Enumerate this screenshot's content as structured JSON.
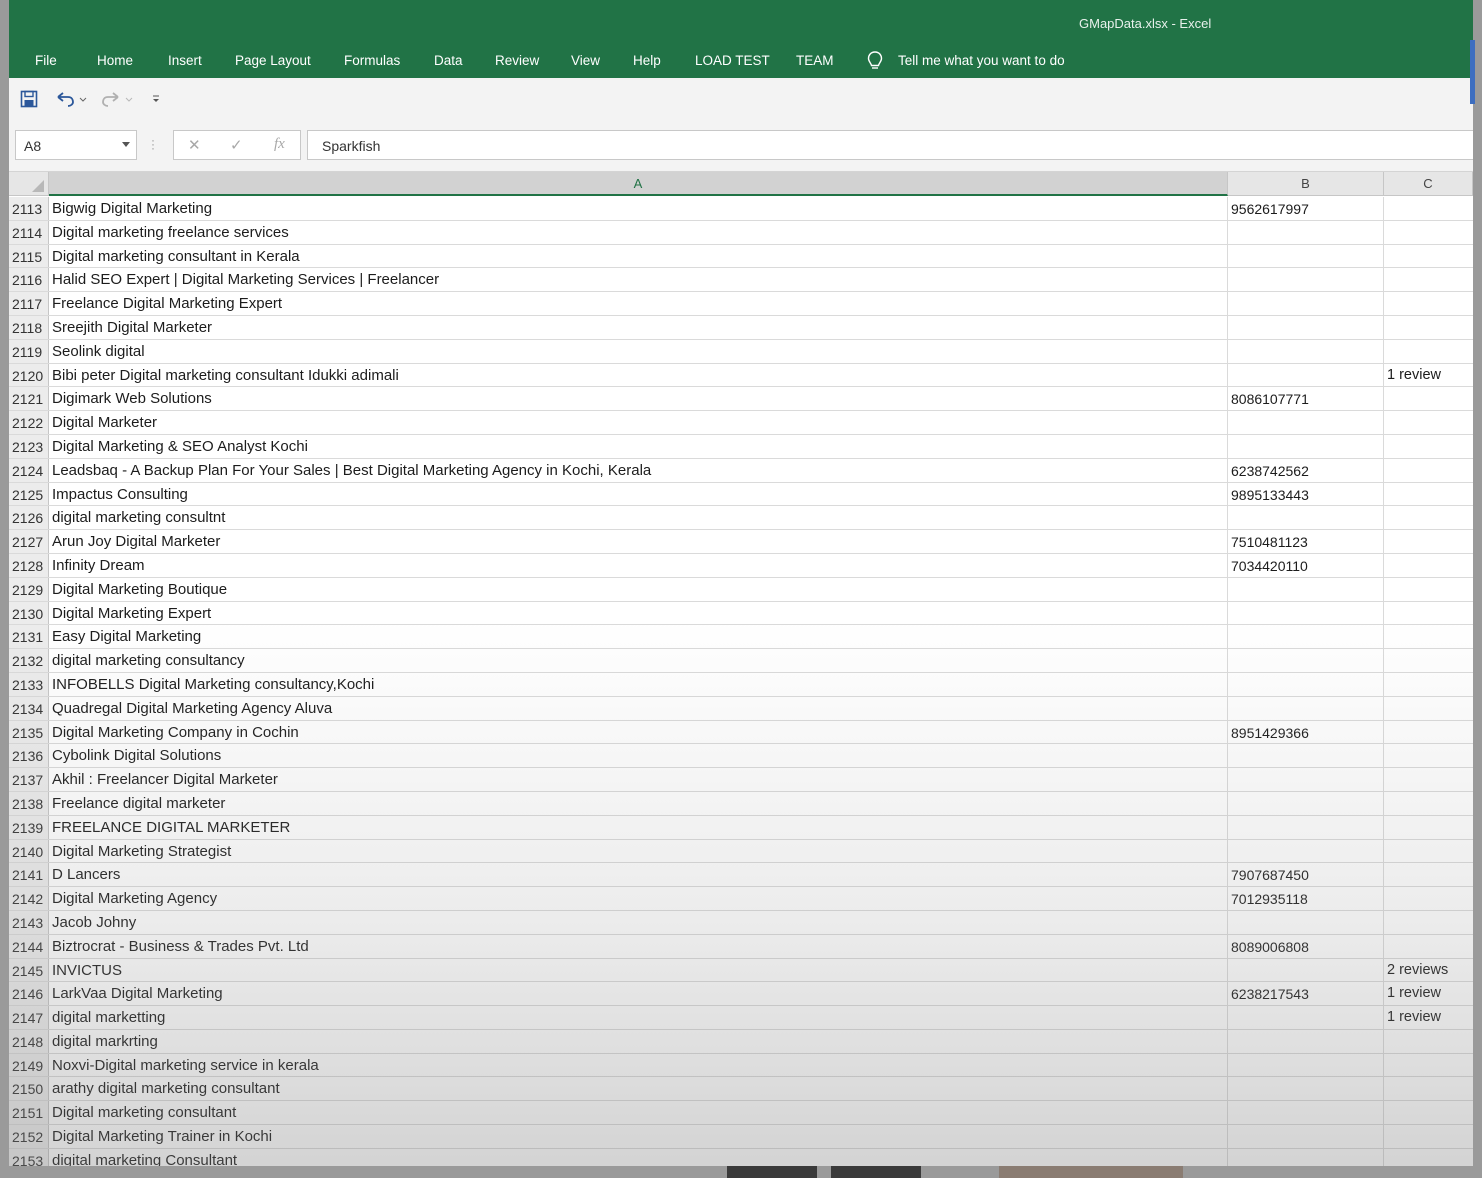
{
  "window": {
    "title": "GMapData.xlsx  -  Excel"
  },
  "menu": {
    "tabs": [
      "File",
      "Home",
      "Insert",
      "Page Layout",
      "Formulas",
      "Data",
      "Review",
      "View",
      "Help",
      "LOAD TEST",
      "TEAM"
    ],
    "tell_me": "Tell me what you want to do"
  },
  "formula_bar": {
    "name_box": "A8",
    "fx_label": "fx",
    "value": "Sparkfish"
  },
  "columns": [
    "A",
    "B",
    "C"
  ],
  "rows": [
    {
      "num": "2113",
      "a": "Bigwig Digital Marketing",
      "b": "9562617997",
      "c": ""
    },
    {
      "num": "2114",
      "a": "Digital marketing freelance services",
      "b": "",
      "c": ""
    },
    {
      "num": "2115",
      "a": "Digital marketing consultant in Kerala",
      "b": "",
      "c": ""
    },
    {
      "num": "2116",
      "a": "Halid SEO Expert | Digital Marketing Services | Freelancer",
      "b": "",
      "c": ""
    },
    {
      "num": "2117",
      "a": "Freelance Digital Marketing Expert",
      "b": "",
      "c": ""
    },
    {
      "num": "2118",
      "a": "Sreejith Digital Marketer",
      "b": "",
      "c": ""
    },
    {
      "num": "2119",
      "a": "Seolink digital",
      "b": "",
      "c": ""
    },
    {
      "num": "2120",
      "a": "Bibi peter Digital marketing consultant Idukki adimali",
      "b": "",
      "c": "1 review"
    },
    {
      "num": "2121",
      "a": "Digimark Web Solutions",
      "b": "8086107771",
      "c": ""
    },
    {
      "num": "2122",
      "a": "Digital Marketer",
      "b": "",
      "c": ""
    },
    {
      "num": "2123",
      "a": "Digital Marketing & SEO Analyst Kochi",
      "b": "",
      "c": ""
    },
    {
      "num": "2124",
      "a": "Leadsbaq - A Backup Plan For Your Sales | Best Digital Marketing Agency in Kochi, Kerala",
      "b": "6238742562",
      "c": ""
    },
    {
      "num": "2125",
      "a": "Impactus Consulting",
      "b": "9895133443",
      "c": ""
    },
    {
      "num": "2126",
      "a": "digital marketing consultnt",
      "b": "",
      "c": ""
    },
    {
      "num": "2127",
      "a": "Arun Joy Digital Marketer",
      "b": "7510481123",
      "c": ""
    },
    {
      "num": "2128",
      "a": "Infinity Dream",
      "b": "7034420110",
      "c": ""
    },
    {
      "num": "2129",
      "a": "Digital Marketing Boutique",
      "b": "",
      "c": ""
    },
    {
      "num": "2130",
      "a": "Digital Marketing Expert",
      "b": "",
      "c": ""
    },
    {
      "num": "2131",
      "a": "Easy Digital Marketing",
      "b": "",
      "c": ""
    },
    {
      "num": "2132",
      "a": "digital marketing consultancy",
      "b": "",
      "c": ""
    },
    {
      "num": "2133",
      "a": "INFOBELLS Digital Marketing consultancy,Kochi",
      "b": "",
      "c": ""
    },
    {
      "num": "2134",
      "a": "Quadregal Digital Marketing Agency Aluva",
      "b": "",
      "c": ""
    },
    {
      "num": "2135",
      "a": "Digital Marketing Company in Cochin",
      "b": "8951429366",
      "c": ""
    },
    {
      "num": "2136",
      "a": "Cybolink Digital Solutions",
      "b": "",
      "c": ""
    },
    {
      "num": "2137",
      "a": "Akhil : Freelancer Digital Marketer",
      "b": "",
      "c": ""
    },
    {
      "num": "2138",
      "a": "Freelance digital marketer",
      "b": "",
      "c": ""
    },
    {
      "num": "2139",
      "a": "FREELANCE DIGITAL MARKETER",
      "b": "",
      "c": ""
    },
    {
      "num": "2140",
      "a": "Digital Marketing Strategist",
      "b": "",
      "c": ""
    },
    {
      "num": "2141",
      "a": "D Lancers",
      "b": "7907687450",
      "c": ""
    },
    {
      "num": "2142",
      "a": "Digital Marketing Agency",
      "b": "7012935118",
      "c": ""
    },
    {
      "num": "2143",
      "a": "Jacob Johny",
      "b": "",
      "c": ""
    },
    {
      "num": "2144",
      "a": "Biztrocrat - Business & Trades Pvt. Ltd",
      "b": "8089006808",
      "c": ""
    },
    {
      "num": "2145",
      "a": "INVICTUS",
      "b": "",
      "c": "2 reviews"
    },
    {
      "num": "2146",
      "a": "LarkVaa Digital Marketing",
      "b": "6238217543",
      "c": "1 review"
    },
    {
      "num": "2147",
      "a": "digital marketting",
      "b": "",
      "c": "1 review"
    },
    {
      "num": "2148",
      "a": "digital markrting",
      "b": "",
      "c": ""
    },
    {
      "num": "2149",
      "a": "Noxvi-Digital marketing service in kerala",
      "b": "",
      "c": ""
    },
    {
      "num": "2150",
      "a": "arathy digital marketing consultant",
      "b": "",
      "c": ""
    },
    {
      "num": "2151",
      "a": "Digital marketing consultant",
      "b": "",
      "c": ""
    },
    {
      "num": "2152",
      "a": "Digital Marketing Trainer in Kochi",
      "b": "",
      "c": ""
    },
    {
      "num": "2153",
      "a": "digital marketing Consultant",
      "b": "",
      "c": ""
    }
  ],
  "colors": {
    "ribbon": "#217346",
    "selected_header": "#217346"
  }
}
